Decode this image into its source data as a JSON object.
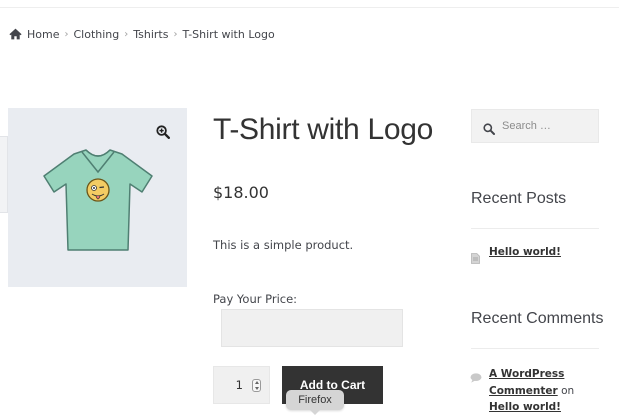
{
  "breadcrumb": {
    "home_icon": "home-icon",
    "items": [
      "Home",
      "Clothing",
      "Tshirts",
      "T-Shirt with Logo"
    ],
    "separator": "›"
  },
  "gallery": {
    "zoom_icon": "zoom-in-icon",
    "image_alt": "T-Shirt with Logo",
    "shirt_color": "#97d4bd",
    "background_color": "#e9ecf1"
  },
  "product": {
    "title": "T-Shirt with Logo",
    "price": "$18.00",
    "description": "This is a simple product.",
    "pay_label": "Pay Your Price:",
    "pay_value": "",
    "quantity": "1",
    "add_to_cart_label": "Add to Cart"
  },
  "tooltip": {
    "text": "Firefox"
  },
  "sidebar": {
    "search": {
      "icon": "search-icon",
      "placeholder": "Search …"
    },
    "recent_posts": {
      "title": "Recent Posts",
      "items": [
        {
          "label": "Hello world!",
          "icon": "document-icon"
        }
      ]
    },
    "recent_comments": {
      "title": "Recent Comments",
      "icon": "comment-icon",
      "items": [
        {
          "author": "A WordPress Commenter",
          "connector": "on",
          "post": "Hello world!"
        }
      ]
    }
  },
  "colors": {
    "text": "#43454b",
    "heading": "#333333",
    "button_bg": "#333333",
    "button_text": "#ffffff",
    "input_bg": "#f0f0f0"
  }
}
